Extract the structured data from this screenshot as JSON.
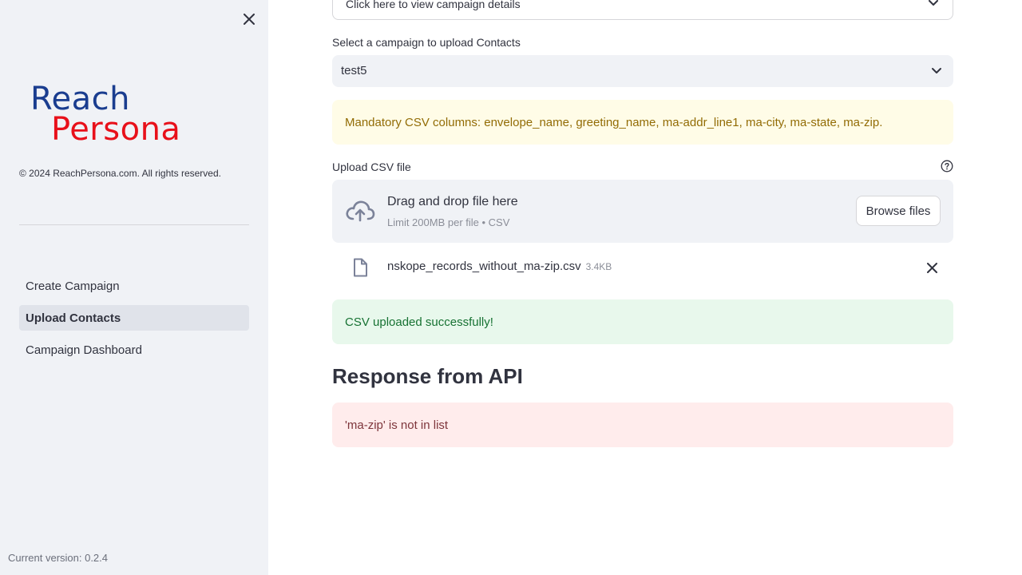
{
  "sidebar": {
    "logo": {
      "line1": "Reach",
      "line2": "Persona",
      "color1": "#1a3d8f",
      "color2": "#e8101a"
    },
    "copyright": "© 2024 ReachPersona.com. All rights reserved.",
    "nav": [
      {
        "label": "Create Campaign",
        "active": false
      },
      {
        "label": "Upload Contacts",
        "active": true
      },
      {
        "label": "Campaign Dashboard",
        "active": false
      }
    ],
    "version": "Current version: 0.2.4",
    "close_icon": "close-icon"
  },
  "main": {
    "expander_label": "Click here to view campaign details",
    "campaign_select": {
      "label": "Select a campaign to upload Contacts",
      "value": "test5"
    },
    "warning": "Mandatory CSV columns: envelope_name, greeting_name, ma-addr_line1, ma-city, ma-state, ma-zip.",
    "uploader": {
      "label": "Upload CSV file",
      "drop_title": "Drag and drop file here",
      "limit": "Limit 200MB per file • CSV",
      "browse_label": "Browse files"
    },
    "uploaded_file": {
      "name": "nskope_records_without_ma-zip.csv",
      "size": "3.4KB"
    },
    "success": "CSV uploaded successfully!",
    "response_heading": "Response from API",
    "error": "'ma-zip' is not in list"
  },
  "colors": {
    "warning_bg": "#fffce7",
    "success_bg": "#e8f8ec",
    "error_bg": "#ffecec",
    "sidebar_bg": "#f0f2f6"
  }
}
